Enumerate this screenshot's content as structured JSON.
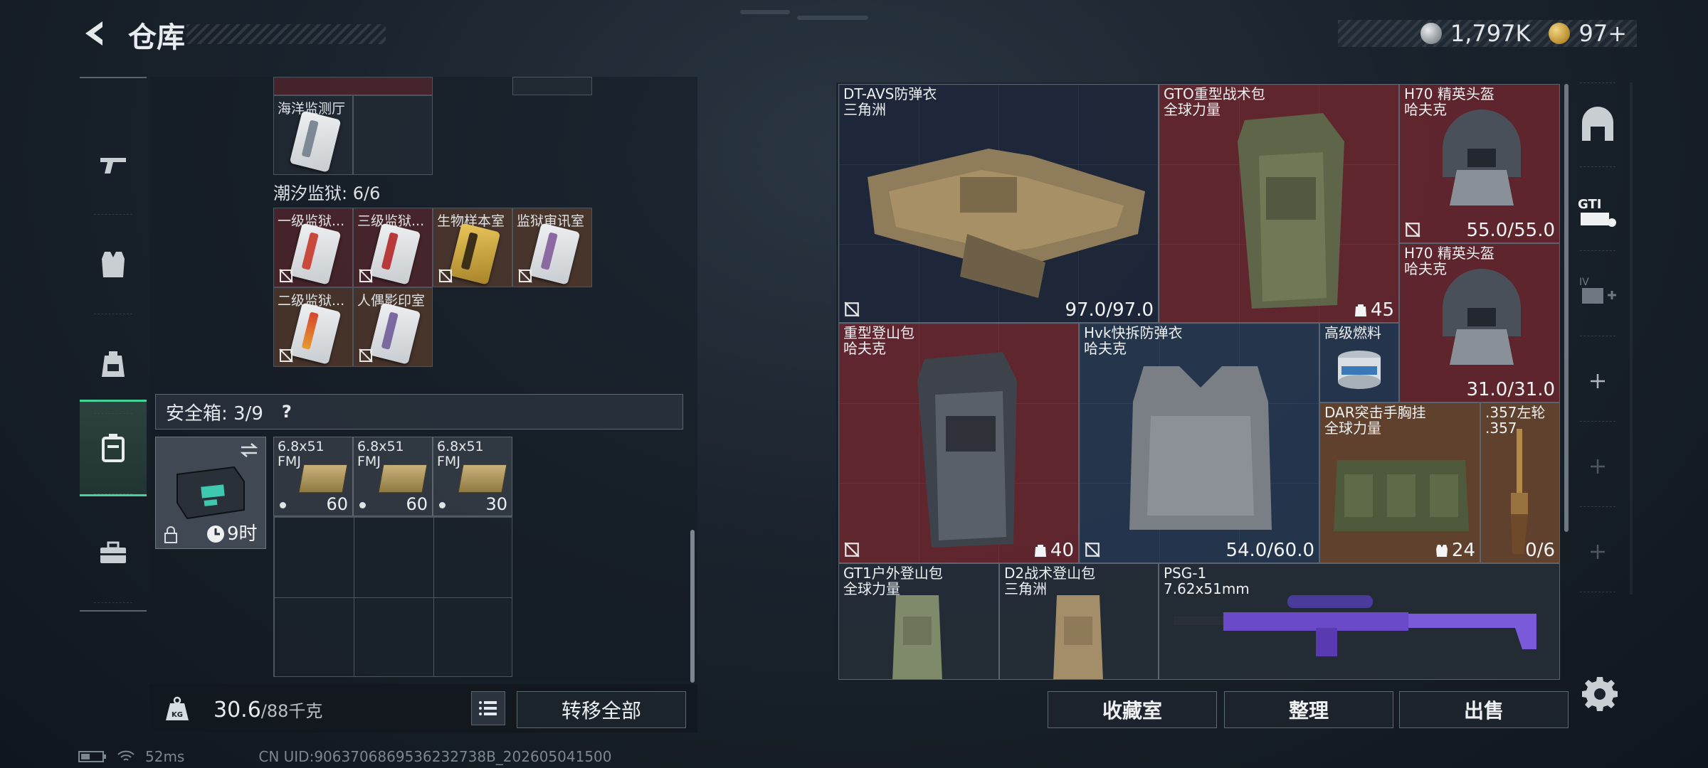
{
  "header": {
    "title": "仓库",
    "silver_amount": "1,797K",
    "gold_amount": "97+"
  },
  "left_nav": {
    "items": [
      {
        "icon": "pistol-icon"
      },
      {
        "icon": "vest-icon"
      },
      {
        "icon": "backpack-icon"
      },
      {
        "icon": "safebox-icon",
        "active": true
      },
      {
        "icon": "toolbox-icon"
      }
    ]
  },
  "keycards": {
    "top_item": "海洋监测厅",
    "section_title": "潮汐监狱: 6/6",
    "items": [
      {
        "label": "一级监狱...",
        "color": "red"
      },
      {
        "label": "三级监狱...",
        "color": "red"
      },
      {
        "label": "生物样本室",
        "color": "brown"
      },
      {
        "label": "监狱审讯室",
        "color": "brown"
      },
      {
        "label": "二级监狱...",
        "color": "brown"
      },
      {
        "label": "人偶影印室",
        "color": "brown"
      }
    ]
  },
  "safebox": {
    "label": "安全箱: 3/9",
    "help": "?",
    "timer": "9时",
    "ammo": [
      {
        "line1": "6.8x51",
        "line2": "FMJ",
        "qty": "60"
      },
      {
        "line1": "6.8x51",
        "line2": "FMJ",
        "qty": "60"
      },
      {
        "line1": "6.8x51",
        "line2": "FMJ",
        "qty": "30"
      }
    ]
  },
  "weight": {
    "current": "30.6",
    "max": "/88千克"
  },
  "transfer_all": "转移全部",
  "status": {
    "ping": "52ms",
    "uid": "CN UID:9063706869536232738B_202605041500"
  },
  "stash": [
    {
      "name": "DT-AVS防弹衣",
      "sub": "三角洲",
      "value": "97.0/97.0",
      "color": "navy"
    },
    {
      "name": "GTO重型战术包",
      "sub": "全球力量",
      "value": "45",
      "color": "red"
    },
    {
      "name": "H70 精英头盔",
      "sub": "哈夫克",
      "value": "55.0/55.0",
      "color": "red"
    },
    {
      "name": "H70 精英头盔",
      "sub": "哈夫克",
      "value": "31.0/31.0",
      "color": "red"
    },
    {
      "name": "重型登山包",
      "sub": "哈夫克",
      "value": "40",
      "color": "red"
    },
    {
      "name": "Hvk快拆防弹衣",
      "sub": "哈夫克",
      "value": "54.0/60.0",
      "color": "blue"
    },
    {
      "name": "高级燃料",
      "sub": "",
      "value": "",
      "color": "blue"
    },
    {
      "name": "DAR突击手胸挂",
      "sub": "全球力量",
      "value": "24",
      "color": "brown"
    },
    {
      "name": ".357左轮",
      "sub": ".357",
      "value": "0/6",
      "color": "brown"
    },
    {
      "name": "GT1户外登山包",
      "sub": "全球力量",
      "value": "",
      "color": "dark"
    },
    {
      "name": "D2战术登山包",
      "sub": "三角洲",
      "value": "",
      "color": "dark"
    },
    {
      "name": "PSG-1",
      "sub": "7.62x51mm",
      "value": "",
      "color": "dark"
    }
  ],
  "actions": {
    "collection": "收藏室",
    "sort": "整理",
    "sell": "出售"
  }
}
